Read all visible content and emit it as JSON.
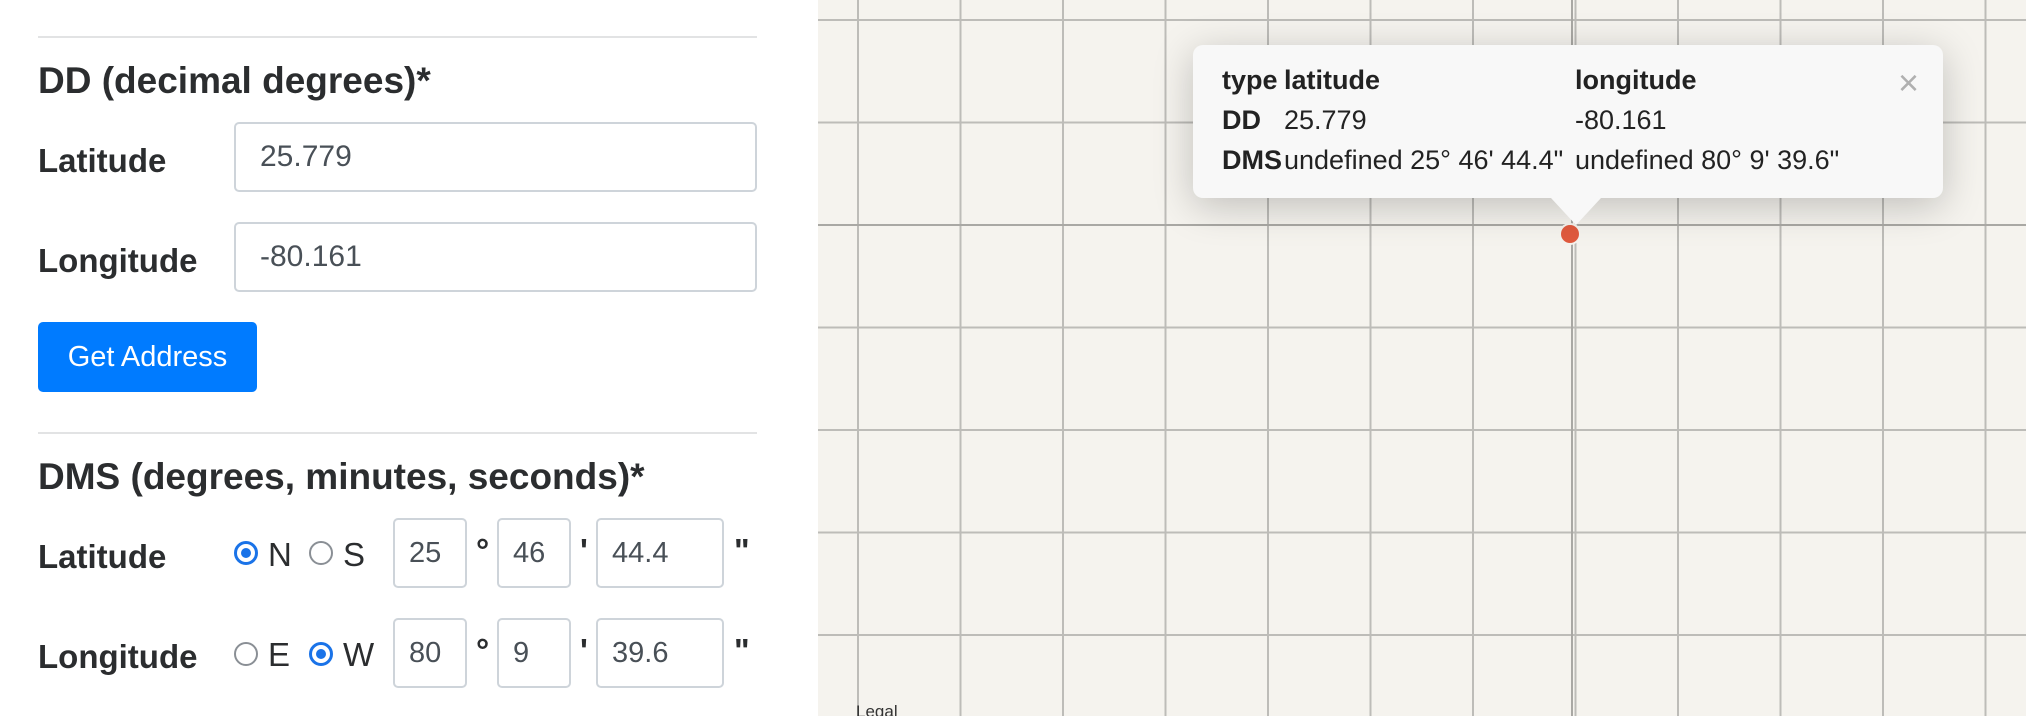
{
  "dd_section": {
    "heading": "DD (decimal degrees)*",
    "latitude_label": "Latitude",
    "latitude_value": "25.779",
    "longitude_label": "Longitude",
    "longitude_value": "-80.161",
    "get_address_label": "Get Address"
  },
  "dms_section": {
    "heading": "DMS (degrees, minutes, seconds)*",
    "latitude": {
      "label": "Latitude",
      "hemisphere_options": [
        "N",
        "S"
      ],
      "hemisphere_selected": "N",
      "degrees": "25",
      "minutes": "46",
      "seconds": "44.4"
    },
    "longitude": {
      "label": "Longitude",
      "hemisphere_options": [
        "E",
        "W"
      ],
      "hemisphere_selected": "W",
      "degrees": "80",
      "minutes": "9",
      "seconds": "39.6"
    },
    "degree_symbol": "°",
    "minute_symbol": "'",
    "second_symbol": "\""
  },
  "map": {
    "legal_label": "Legal",
    "marker_color": "#e05a3e",
    "popup": {
      "header": [
        "type",
        "latitude",
        "longitude"
      ],
      "rows": [
        [
          "DD",
          "25.779",
          "-80.161"
        ],
        [
          "DMS",
          "undefined 25° 46' 44.4\"",
          "undefined 80° 9' 39.6\""
        ]
      ],
      "close_icon": "×"
    }
  },
  "colors": {
    "primary": "#007bff",
    "radio_selected": "#1a73e8"
  }
}
